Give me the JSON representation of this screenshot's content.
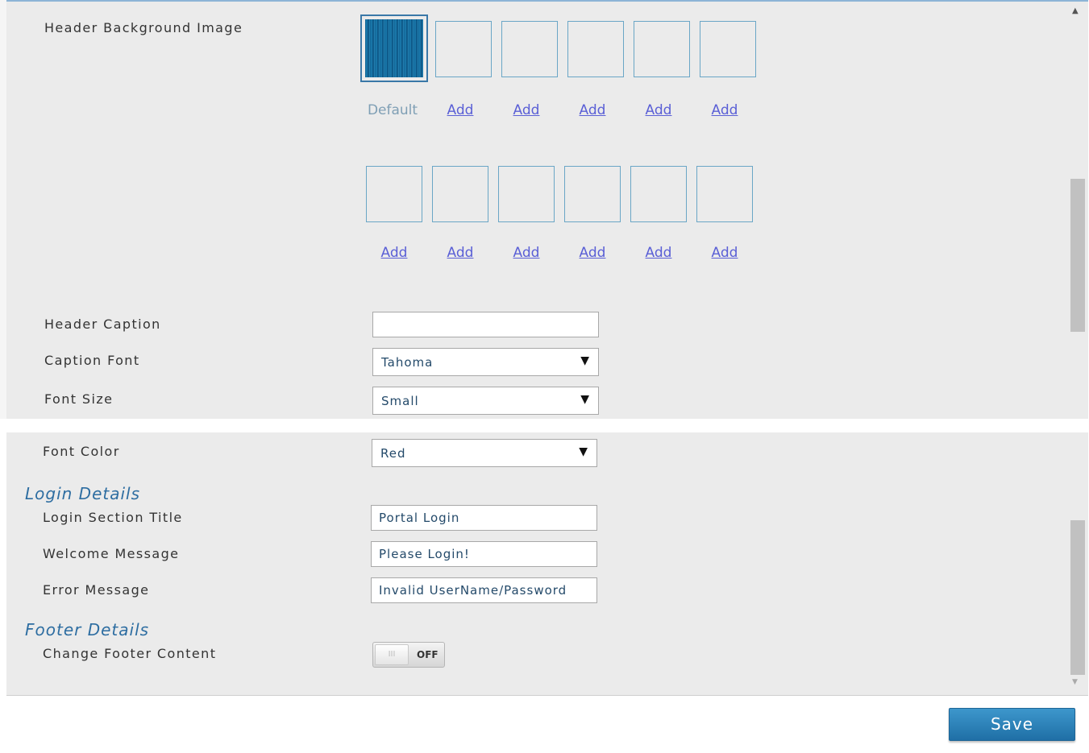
{
  "header_section": {
    "background_image_label": "Header Background Image",
    "row1": [
      "Default",
      "Add",
      "Add",
      "Add",
      "Add",
      "Add"
    ],
    "row2": [
      "Add",
      "Add",
      "Add",
      "Add",
      "Add",
      "Add"
    ],
    "caption_label": "Header Caption",
    "caption_value": "",
    "caption_font_label": "Caption Font",
    "caption_font_value": "Tahoma",
    "font_size_label": "Font Size",
    "font_size_value": "Small",
    "font_color_label": "Font Color",
    "font_color_value": "Red"
  },
  "login_details": {
    "title": "Login Details",
    "section_title_label": "Login Section Title",
    "section_title_value": "Portal Login",
    "welcome_label": "Welcome Message",
    "welcome_value": "Please Login!",
    "error_label": "Error Message",
    "error_value": "Invalid UserName/Password"
  },
  "footer_details": {
    "title": "Footer Details",
    "change_footer_label": "Change Footer Content",
    "toggle_grip": "III",
    "toggle_state": "OFF"
  },
  "actions": {
    "save_label": "Save"
  },
  "icons": {
    "dropdown": "▼",
    "scroll_up": "▲",
    "scroll_down": "▼"
  },
  "colors": {
    "accent": "#2d6da1",
    "link": "#5a5fd6",
    "button": "#2a80b9"
  }
}
